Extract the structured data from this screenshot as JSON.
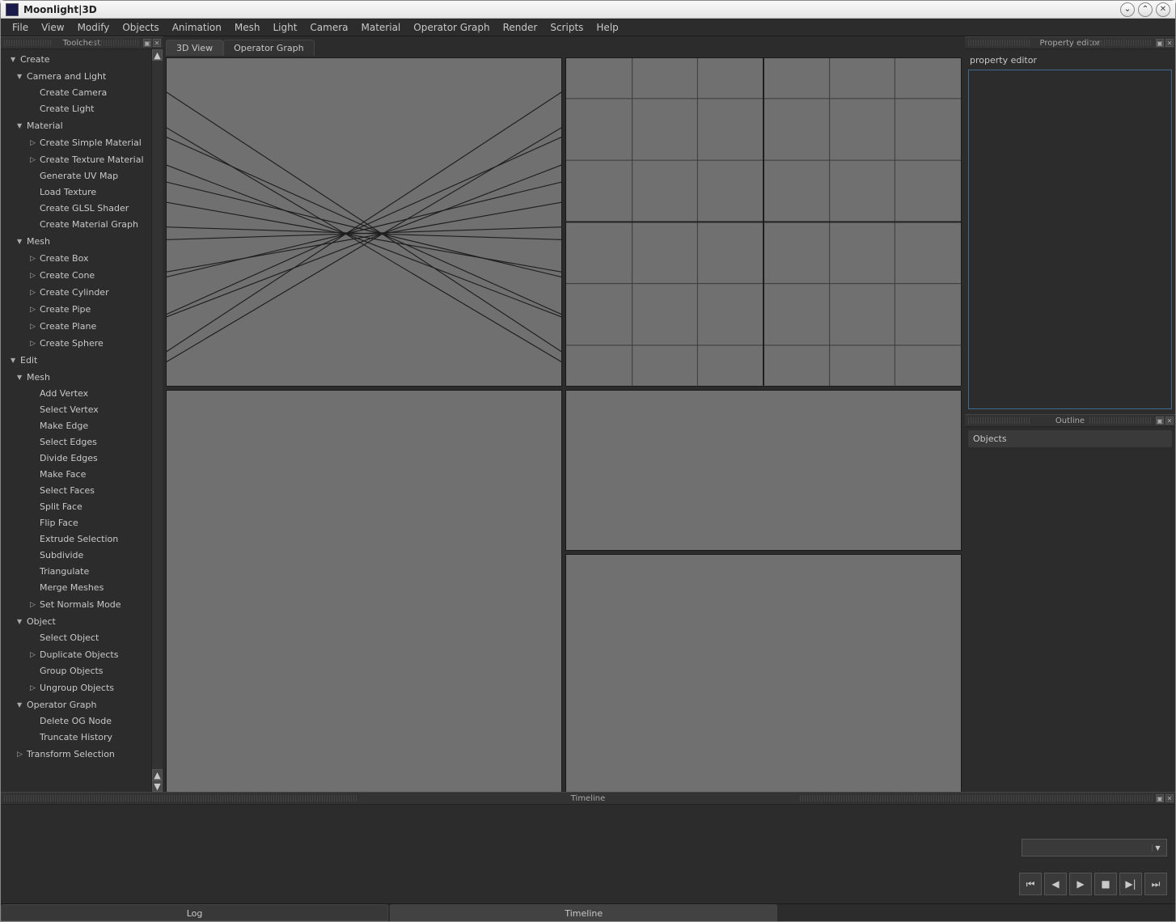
{
  "window": {
    "title": "Moonlight|3D"
  },
  "menubar": [
    "File",
    "View",
    "Modify",
    "Objects",
    "Animation",
    "Mesh",
    "Light",
    "Camera",
    "Material",
    "Operator Graph",
    "Render",
    "Scripts",
    "Help"
  ],
  "panels": {
    "toolchest": "Toolchest",
    "property_editor": "Property editor",
    "property_label": "property editor",
    "outline": "Outline",
    "objects": "Objects",
    "timeline": "Timeline"
  },
  "tabs": {
    "view3d": "3D View",
    "opgraph": "Operator Graph"
  },
  "bottom_tabs": {
    "log": "Log",
    "timeline": "Timeline"
  },
  "tree": [
    {
      "level": 0,
      "arrow": "down",
      "label": "Create"
    },
    {
      "level": 1,
      "arrow": "down",
      "label": "Camera and Light"
    },
    {
      "level": 2,
      "arrow": "",
      "label": "Create Camera"
    },
    {
      "level": 2,
      "arrow": "",
      "label": "Create Light"
    },
    {
      "level": 1,
      "arrow": "down",
      "label": "Material"
    },
    {
      "level": 2,
      "arrow": "right",
      "label": "Create Simple Material"
    },
    {
      "level": 2,
      "arrow": "right",
      "label": "Create Texture Material"
    },
    {
      "level": 2,
      "arrow": "",
      "label": "Generate UV Map"
    },
    {
      "level": 2,
      "arrow": "",
      "label": "Load Texture"
    },
    {
      "level": 2,
      "arrow": "",
      "label": "Create GLSL Shader"
    },
    {
      "level": 2,
      "arrow": "",
      "label": "Create Material Graph"
    },
    {
      "level": 1,
      "arrow": "down",
      "label": "Mesh"
    },
    {
      "level": 2,
      "arrow": "right",
      "label": "Create Box"
    },
    {
      "level": 2,
      "arrow": "right",
      "label": "Create Cone"
    },
    {
      "level": 2,
      "arrow": "right",
      "label": "Create Cylinder"
    },
    {
      "level": 2,
      "arrow": "right",
      "label": "Create Pipe"
    },
    {
      "level": 2,
      "arrow": "right",
      "label": "Create Plane"
    },
    {
      "level": 2,
      "arrow": "right",
      "label": "Create Sphere"
    },
    {
      "level": 0,
      "arrow": "down",
      "label": "Edit"
    },
    {
      "level": 1,
      "arrow": "down",
      "label": "Mesh"
    },
    {
      "level": 2,
      "arrow": "",
      "label": "Add Vertex"
    },
    {
      "level": 2,
      "arrow": "",
      "label": "Select Vertex"
    },
    {
      "level": 2,
      "arrow": "",
      "label": "Make Edge"
    },
    {
      "level": 2,
      "arrow": "",
      "label": "Select Edges"
    },
    {
      "level": 2,
      "arrow": "",
      "label": "Divide Edges"
    },
    {
      "level": 2,
      "arrow": "",
      "label": "Make Face"
    },
    {
      "level": 2,
      "arrow": "",
      "label": "Select Faces"
    },
    {
      "level": 2,
      "arrow": "",
      "label": "Split Face"
    },
    {
      "level": 2,
      "arrow": "",
      "label": "Flip Face"
    },
    {
      "level": 2,
      "arrow": "",
      "label": "Extrude Selection"
    },
    {
      "level": 2,
      "arrow": "",
      "label": "Subdivide"
    },
    {
      "level": 2,
      "arrow": "",
      "label": "Triangulate"
    },
    {
      "level": 2,
      "arrow": "",
      "label": "Merge Meshes"
    },
    {
      "level": 2,
      "arrow": "right",
      "label": "Set Normals Mode"
    },
    {
      "level": 1,
      "arrow": "down",
      "label": "Object"
    },
    {
      "level": 2,
      "arrow": "",
      "label": "Select Object"
    },
    {
      "level": 2,
      "arrow": "right",
      "label": "Duplicate Objects"
    },
    {
      "level": 2,
      "arrow": "",
      "label": "Group Objects"
    },
    {
      "level": 2,
      "arrow": "right",
      "label": "Ungroup Objects"
    },
    {
      "level": 1,
      "arrow": "down",
      "label": "Operator Graph"
    },
    {
      "level": 2,
      "arrow": "",
      "label": "Delete OG Node"
    },
    {
      "level": 2,
      "arrow": "",
      "label": "Truncate History"
    },
    {
      "level": 1,
      "arrow": "right",
      "label": "Transform Selection"
    }
  ]
}
